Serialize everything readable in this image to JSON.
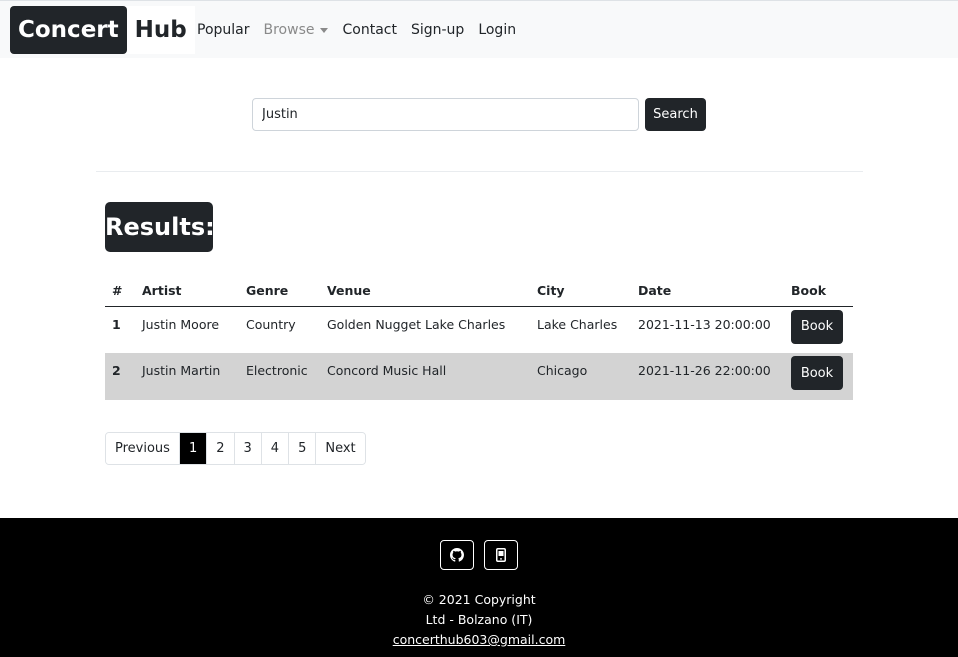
{
  "navbar": {
    "brand_part1": "Concert",
    "brand_part2": "Hub",
    "links": {
      "popular": "Popular",
      "browse": "Browse",
      "contact": "Contact",
      "signup": "Sign-up",
      "login": "Login"
    }
  },
  "search": {
    "value": "Justin",
    "button_label": "Search"
  },
  "results_heading": "Results:",
  "table": {
    "headers": [
      "#",
      "Artist",
      "Genre",
      "Venue",
      "City",
      "Date",
      "Book"
    ],
    "rows": [
      {
        "num": "1",
        "artist": "Justin Moore",
        "genre": "Country",
        "venue": "Golden Nugget Lake Charles",
        "city": "Lake Charles",
        "date": "2021-11-13 20:00:00",
        "book": "Book"
      },
      {
        "num": "2",
        "artist": "Justin Martin",
        "genre": "Electronic",
        "venue": "Concord Music Hall",
        "city": "Chicago",
        "date": "2021-11-26 22:00:00",
        "book": "Book"
      }
    ]
  },
  "pagination": {
    "previous": "Previous",
    "pages": [
      "1",
      "2",
      "3",
      "4",
      "5"
    ],
    "active": "1",
    "next": "Next"
  },
  "footer": {
    "icons": [
      "github-icon",
      "mobile-icon"
    ],
    "copyright": "© 2021 Copyright",
    "company": "Ltd - Bolzano (IT)",
    "email": "concerthub603@gmail.com"
  },
  "colors": {
    "dark": "#212529",
    "navbar_bg": "#f8f9fa",
    "striped_row": "#d3d3d3",
    "footer_bg": "#000000"
  }
}
